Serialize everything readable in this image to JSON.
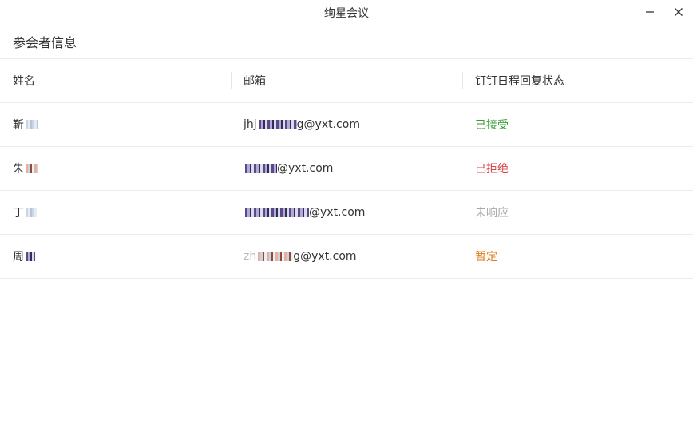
{
  "window": {
    "title": "绚星会议",
    "minimize_glyph": "−",
    "close_glyph": "×"
  },
  "section": {
    "title": "参会者信息"
  },
  "table": {
    "columns": [
      "姓名",
      "邮箱",
      "钉钉日程回复状态"
    ],
    "rows": [
      {
        "name": "靳",
        "email_visible": "jhj",
        "email_suffix": "g@yxt.com",
        "status": "已接受",
        "status_color": "#3a9d3a"
      },
      {
        "name": "朱",
        "email_visible": "",
        "email_suffix": "@yxt.com",
        "status": "已拒绝",
        "status_color": "#d64545"
      },
      {
        "name": "丁",
        "email_visible": "",
        "email_suffix": "@yxt.com",
        "status": "未响应",
        "status_color": "#aaaaaa"
      },
      {
        "name": "周",
        "email_visible": "zh",
        "email_suffix": "g@yxt.com",
        "status": "暂定",
        "status_color": "#e07b1a"
      }
    ]
  },
  "icons": {
    "minimize": "minimize-icon",
    "close": "close-icon"
  }
}
